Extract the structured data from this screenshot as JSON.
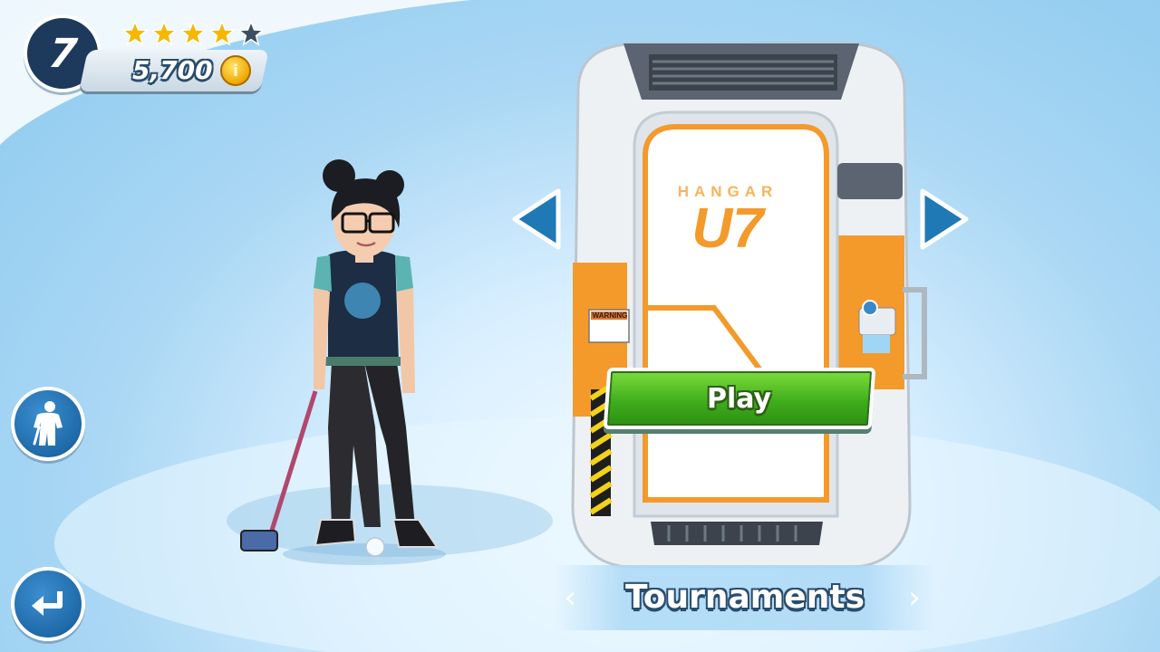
{
  "player": {
    "level": "7",
    "stars": {
      "filled": 4,
      "total": 5
    },
    "coins": "5,700"
  },
  "play_button": {
    "label": "Play"
  },
  "mode_selector": {
    "label": "Tournaments",
    "prev": "‹",
    "next": "›"
  },
  "pod": {
    "brand_top": "HANGAR",
    "brand_bottom": "U7",
    "warning_label": "WARNING"
  },
  "icons": {
    "customize": "golfer-customize-icon",
    "back": "return-arrow-icon",
    "coin": "coin-icon",
    "star": "star-icon"
  },
  "colors": {
    "accent_orange": "#f39a2b",
    "play_green": "#3fae1c",
    "badge_navy": "#1d3a5c",
    "button_blue": "#1f6aa8",
    "star_gold": "#f5b800",
    "star_empty": "#3c4f60"
  }
}
